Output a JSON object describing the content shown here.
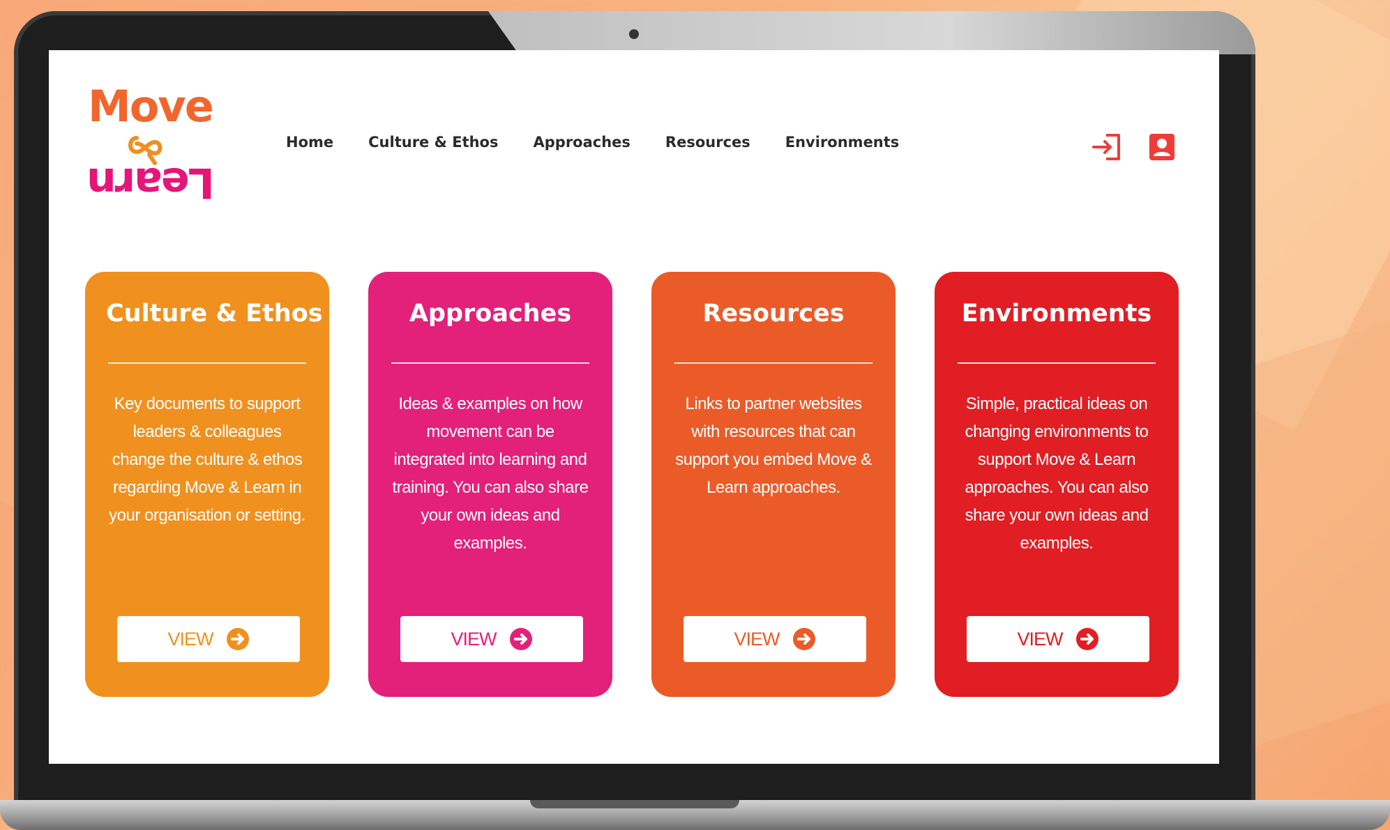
{
  "colors": {
    "orange": "#f0901e",
    "pink": "#e3207a",
    "burnt_orange": "#eb5b28",
    "red": "#e01e24",
    "logo_orange": "#f0662c",
    "logo_pink": "#e5157a",
    "nav_icon": "#ec3d3a"
  },
  "logo": {
    "word1": "Move",
    "word2": "Learn",
    "ampersand_icon": "infinity-ampersand-icon"
  },
  "nav": {
    "items": [
      "Home",
      "Culture & Ethos",
      "Approaches",
      "Resources",
      "Environments"
    ],
    "icons": [
      "login-icon",
      "user-account-icon"
    ]
  },
  "cards": [
    {
      "title": "Culture & Ethos",
      "description": "Key documents to support leaders & colleagues change the culture & ethos regarding Move & Learn in your organisation or setting.",
      "button_label": "VIEW",
      "color": "#f0901e"
    },
    {
      "title": "Approaches",
      "description": "Ideas & examples on how movement can be integrated into learning and training. You can also share your own ideas and examples.",
      "button_label": "VIEW",
      "color": "#e3207a"
    },
    {
      "title": "Resources",
      "description": "Links to partner websites with resources that can support you embed Move & Learn approaches.",
      "button_label": "VIEW",
      "color": "#eb5b28"
    },
    {
      "title": "Environments",
      "description": "Simple, practical ideas on changing environments to support Move & Learn approaches. You can also share your own ideas and examples.",
      "button_label": "VIEW",
      "color": "#e01e24"
    }
  ]
}
